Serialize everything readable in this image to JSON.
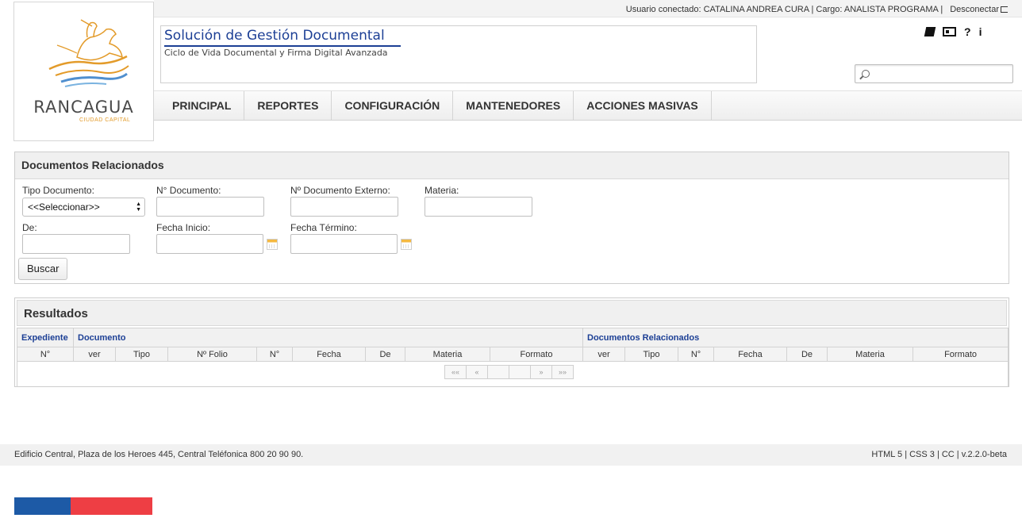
{
  "header": {
    "user_label": "Usuario conectado: CATALINA ANDREA CURA | Cargo: ANALISTA PROGRAMA |",
    "logout_label": "Desconectar",
    "logo_city": "RANCAGUA",
    "logo_tagline": "CIUDAD CAPITAL",
    "app_title": "Solución de Gestión Documental",
    "app_subtitle": "Ciclo de Vida Documental y Firma Digital Avanzada",
    "help_label": "?",
    "info_label": "i",
    "search_placeholder": ""
  },
  "nav": {
    "items": [
      "PRINCIPAL",
      "REPORTES",
      "CONFIGURACIÓN",
      "MANTENEDORES",
      "ACCIONES MASIVAS"
    ]
  },
  "search_panel": {
    "title": "Documentos Relacionados",
    "tipo_documento_label": "Tipo Documento:",
    "tipo_documento_value": "<<Seleccionar>>",
    "n_documento_label": "N° Documento:",
    "n_documento_externo_label": "Nº Documento Externo:",
    "materia_label": "Materia:",
    "de_label": "De:",
    "fecha_inicio_label": "Fecha Inicio:",
    "fecha_termino_label": "Fecha Término:",
    "buscar_label": "Buscar"
  },
  "results": {
    "title": "Resultados",
    "group_expediente": "Expediente",
    "group_documento": "Documento",
    "group_relacionados": "Documentos Relacionados",
    "columns": [
      "N°",
      "ver",
      "Tipo",
      "Nº Folio",
      "N°",
      "Fecha",
      "De",
      "Materia",
      "Formato",
      "ver",
      "Tipo",
      "N°",
      "Fecha",
      "De",
      "Materia",
      "Formato"
    ],
    "pager": [
      "««",
      "«",
      "",
      "",
      "»",
      "»»"
    ]
  },
  "footer": {
    "address": "Edificio Central, Plaza de los Heroes 445, Central Teléfonica 800 20 90 90.",
    "version": "HTML 5 | CSS 3 | CC | v.2.2.0-beta"
  },
  "colors": {
    "brand_blue": "#1c3f95",
    "flag_blue": "#1d5aa6",
    "flag_red": "#ee3e44",
    "logo_orange": "#e39b2a"
  }
}
